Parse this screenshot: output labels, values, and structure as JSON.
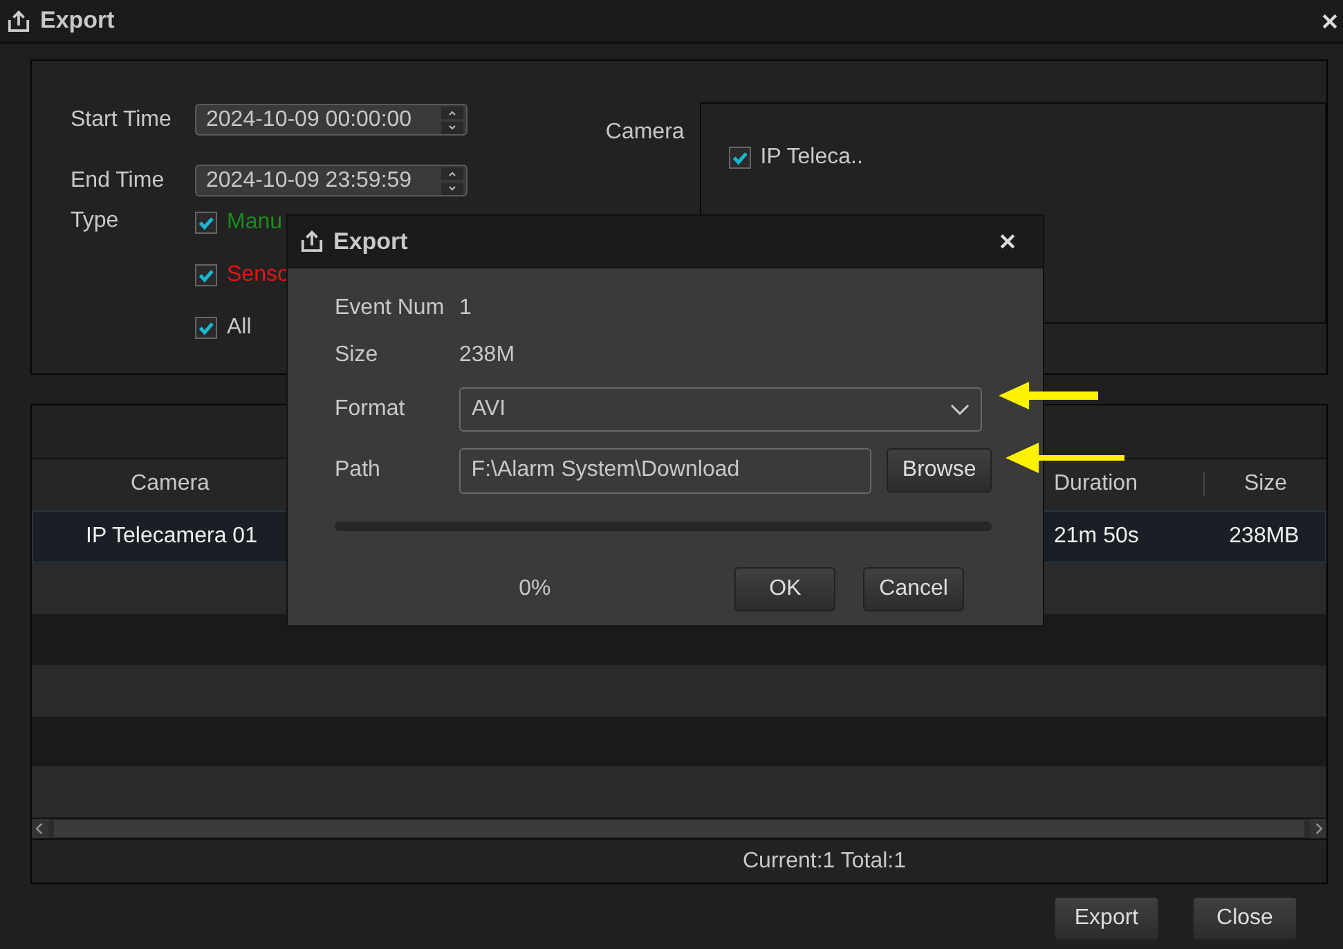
{
  "window": {
    "title": "Export"
  },
  "filter": {
    "start_time": {
      "label": "Start Time",
      "value": "2024-10-09 00:00:00"
    },
    "end_time": {
      "label": "End Time",
      "value": "2024-10-09 23:59:59"
    },
    "type": {
      "label": "Type",
      "options": [
        {
          "label": "Manu",
          "checked": true,
          "color": "#1a8c1a"
        },
        {
          "label": "Senso",
          "checked": true,
          "color": "#e51414"
        },
        {
          "label": "All",
          "checked": true,
          "color": "#c8c8c8"
        }
      ]
    },
    "camera": {
      "label": "Camera",
      "items": [
        {
          "label": "IP Teleca..",
          "checked": true
        }
      ]
    }
  },
  "table": {
    "columns": [
      {
        "label": "Camera"
      },
      {
        "label": "Duration"
      },
      {
        "label": "Size"
      }
    ],
    "rows": [
      {
        "selected": true,
        "cells": [
          "IP Telecamera 01",
          "21m 50s",
          "238MB"
        ]
      }
    ]
  },
  "pagination": "Current:1 Total:1",
  "buttons": [
    "Export",
    "Close"
  ],
  "dialog": {
    "title": "Export",
    "event_num": {
      "label": "Event Num",
      "value": "1"
    },
    "size": {
      "label": "Size",
      "value": "238M"
    },
    "format": {
      "label": "Format",
      "value": "AVI"
    },
    "path": {
      "label": "Path",
      "value": "F:\\Alarm System\\Download",
      "button": "Browse"
    },
    "progress": {
      "level": 0,
      "reading": "0%"
    },
    "buttons": [
      "OK",
      "Cancel"
    ]
  }
}
